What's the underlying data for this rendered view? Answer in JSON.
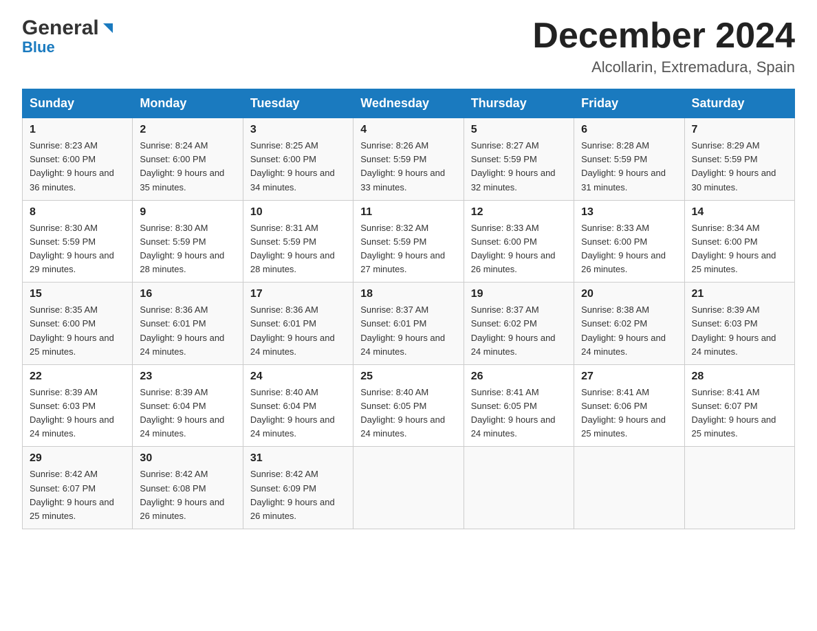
{
  "header": {
    "logo_general": "General",
    "logo_blue": "Blue",
    "month_title": "December 2024",
    "location": "Alcollarin, Extremadura, Spain"
  },
  "days_of_week": [
    "Sunday",
    "Monday",
    "Tuesday",
    "Wednesday",
    "Thursday",
    "Friday",
    "Saturday"
  ],
  "weeks": [
    [
      {
        "num": "1",
        "sunrise": "8:23 AM",
        "sunset": "6:00 PM",
        "daylight": "9 hours and 36 minutes."
      },
      {
        "num": "2",
        "sunrise": "8:24 AM",
        "sunset": "6:00 PM",
        "daylight": "9 hours and 35 minutes."
      },
      {
        "num": "3",
        "sunrise": "8:25 AM",
        "sunset": "6:00 PM",
        "daylight": "9 hours and 34 minutes."
      },
      {
        "num": "4",
        "sunrise": "8:26 AM",
        "sunset": "5:59 PM",
        "daylight": "9 hours and 33 minutes."
      },
      {
        "num": "5",
        "sunrise": "8:27 AM",
        "sunset": "5:59 PM",
        "daylight": "9 hours and 32 minutes."
      },
      {
        "num": "6",
        "sunrise": "8:28 AM",
        "sunset": "5:59 PM",
        "daylight": "9 hours and 31 minutes."
      },
      {
        "num": "7",
        "sunrise": "8:29 AM",
        "sunset": "5:59 PM",
        "daylight": "9 hours and 30 minutes."
      }
    ],
    [
      {
        "num": "8",
        "sunrise": "8:30 AM",
        "sunset": "5:59 PM",
        "daylight": "9 hours and 29 minutes."
      },
      {
        "num": "9",
        "sunrise": "8:30 AM",
        "sunset": "5:59 PM",
        "daylight": "9 hours and 28 minutes."
      },
      {
        "num": "10",
        "sunrise": "8:31 AM",
        "sunset": "5:59 PM",
        "daylight": "9 hours and 28 minutes."
      },
      {
        "num": "11",
        "sunrise": "8:32 AM",
        "sunset": "5:59 PM",
        "daylight": "9 hours and 27 minutes."
      },
      {
        "num": "12",
        "sunrise": "8:33 AM",
        "sunset": "6:00 PM",
        "daylight": "9 hours and 26 minutes."
      },
      {
        "num": "13",
        "sunrise": "8:33 AM",
        "sunset": "6:00 PM",
        "daylight": "9 hours and 26 minutes."
      },
      {
        "num": "14",
        "sunrise": "8:34 AM",
        "sunset": "6:00 PM",
        "daylight": "9 hours and 25 minutes."
      }
    ],
    [
      {
        "num": "15",
        "sunrise": "8:35 AM",
        "sunset": "6:00 PM",
        "daylight": "9 hours and 25 minutes."
      },
      {
        "num": "16",
        "sunrise": "8:36 AM",
        "sunset": "6:01 PM",
        "daylight": "9 hours and 24 minutes."
      },
      {
        "num": "17",
        "sunrise": "8:36 AM",
        "sunset": "6:01 PM",
        "daylight": "9 hours and 24 minutes."
      },
      {
        "num": "18",
        "sunrise": "8:37 AM",
        "sunset": "6:01 PM",
        "daylight": "9 hours and 24 minutes."
      },
      {
        "num": "19",
        "sunrise": "8:37 AM",
        "sunset": "6:02 PM",
        "daylight": "9 hours and 24 minutes."
      },
      {
        "num": "20",
        "sunrise": "8:38 AM",
        "sunset": "6:02 PM",
        "daylight": "9 hours and 24 minutes."
      },
      {
        "num": "21",
        "sunrise": "8:39 AM",
        "sunset": "6:03 PM",
        "daylight": "9 hours and 24 minutes."
      }
    ],
    [
      {
        "num": "22",
        "sunrise": "8:39 AM",
        "sunset": "6:03 PM",
        "daylight": "9 hours and 24 minutes."
      },
      {
        "num": "23",
        "sunrise": "8:39 AM",
        "sunset": "6:04 PM",
        "daylight": "9 hours and 24 minutes."
      },
      {
        "num": "24",
        "sunrise": "8:40 AM",
        "sunset": "6:04 PM",
        "daylight": "9 hours and 24 minutes."
      },
      {
        "num": "25",
        "sunrise": "8:40 AM",
        "sunset": "6:05 PM",
        "daylight": "9 hours and 24 minutes."
      },
      {
        "num": "26",
        "sunrise": "8:41 AM",
        "sunset": "6:05 PM",
        "daylight": "9 hours and 24 minutes."
      },
      {
        "num": "27",
        "sunrise": "8:41 AM",
        "sunset": "6:06 PM",
        "daylight": "9 hours and 25 minutes."
      },
      {
        "num": "28",
        "sunrise": "8:41 AM",
        "sunset": "6:07 PM",
        "daylight": "9 hours and 25 minutes."
      }
    ],
    [
      {
        "num": "29",
        "sunrise": "8:42 AM",
        "sunset": "6:07 PM",
        "daylight": "9 hours and 25 minutes."
      },
      {
        "num": "30",
        "sunrise": "8:42 AM",
        "sunset": "6:08 PM",
        "daylight": "9 hours and 26 minutes."
      },
      {
        "num": "31",
        "sunrise": "8:42 AM",
        "sunset": "6:09 PM",
        "daylight": "9 hours and 26 minutes."
      },
      null,
      null,
      null,
      null
    ]
  ]
}
